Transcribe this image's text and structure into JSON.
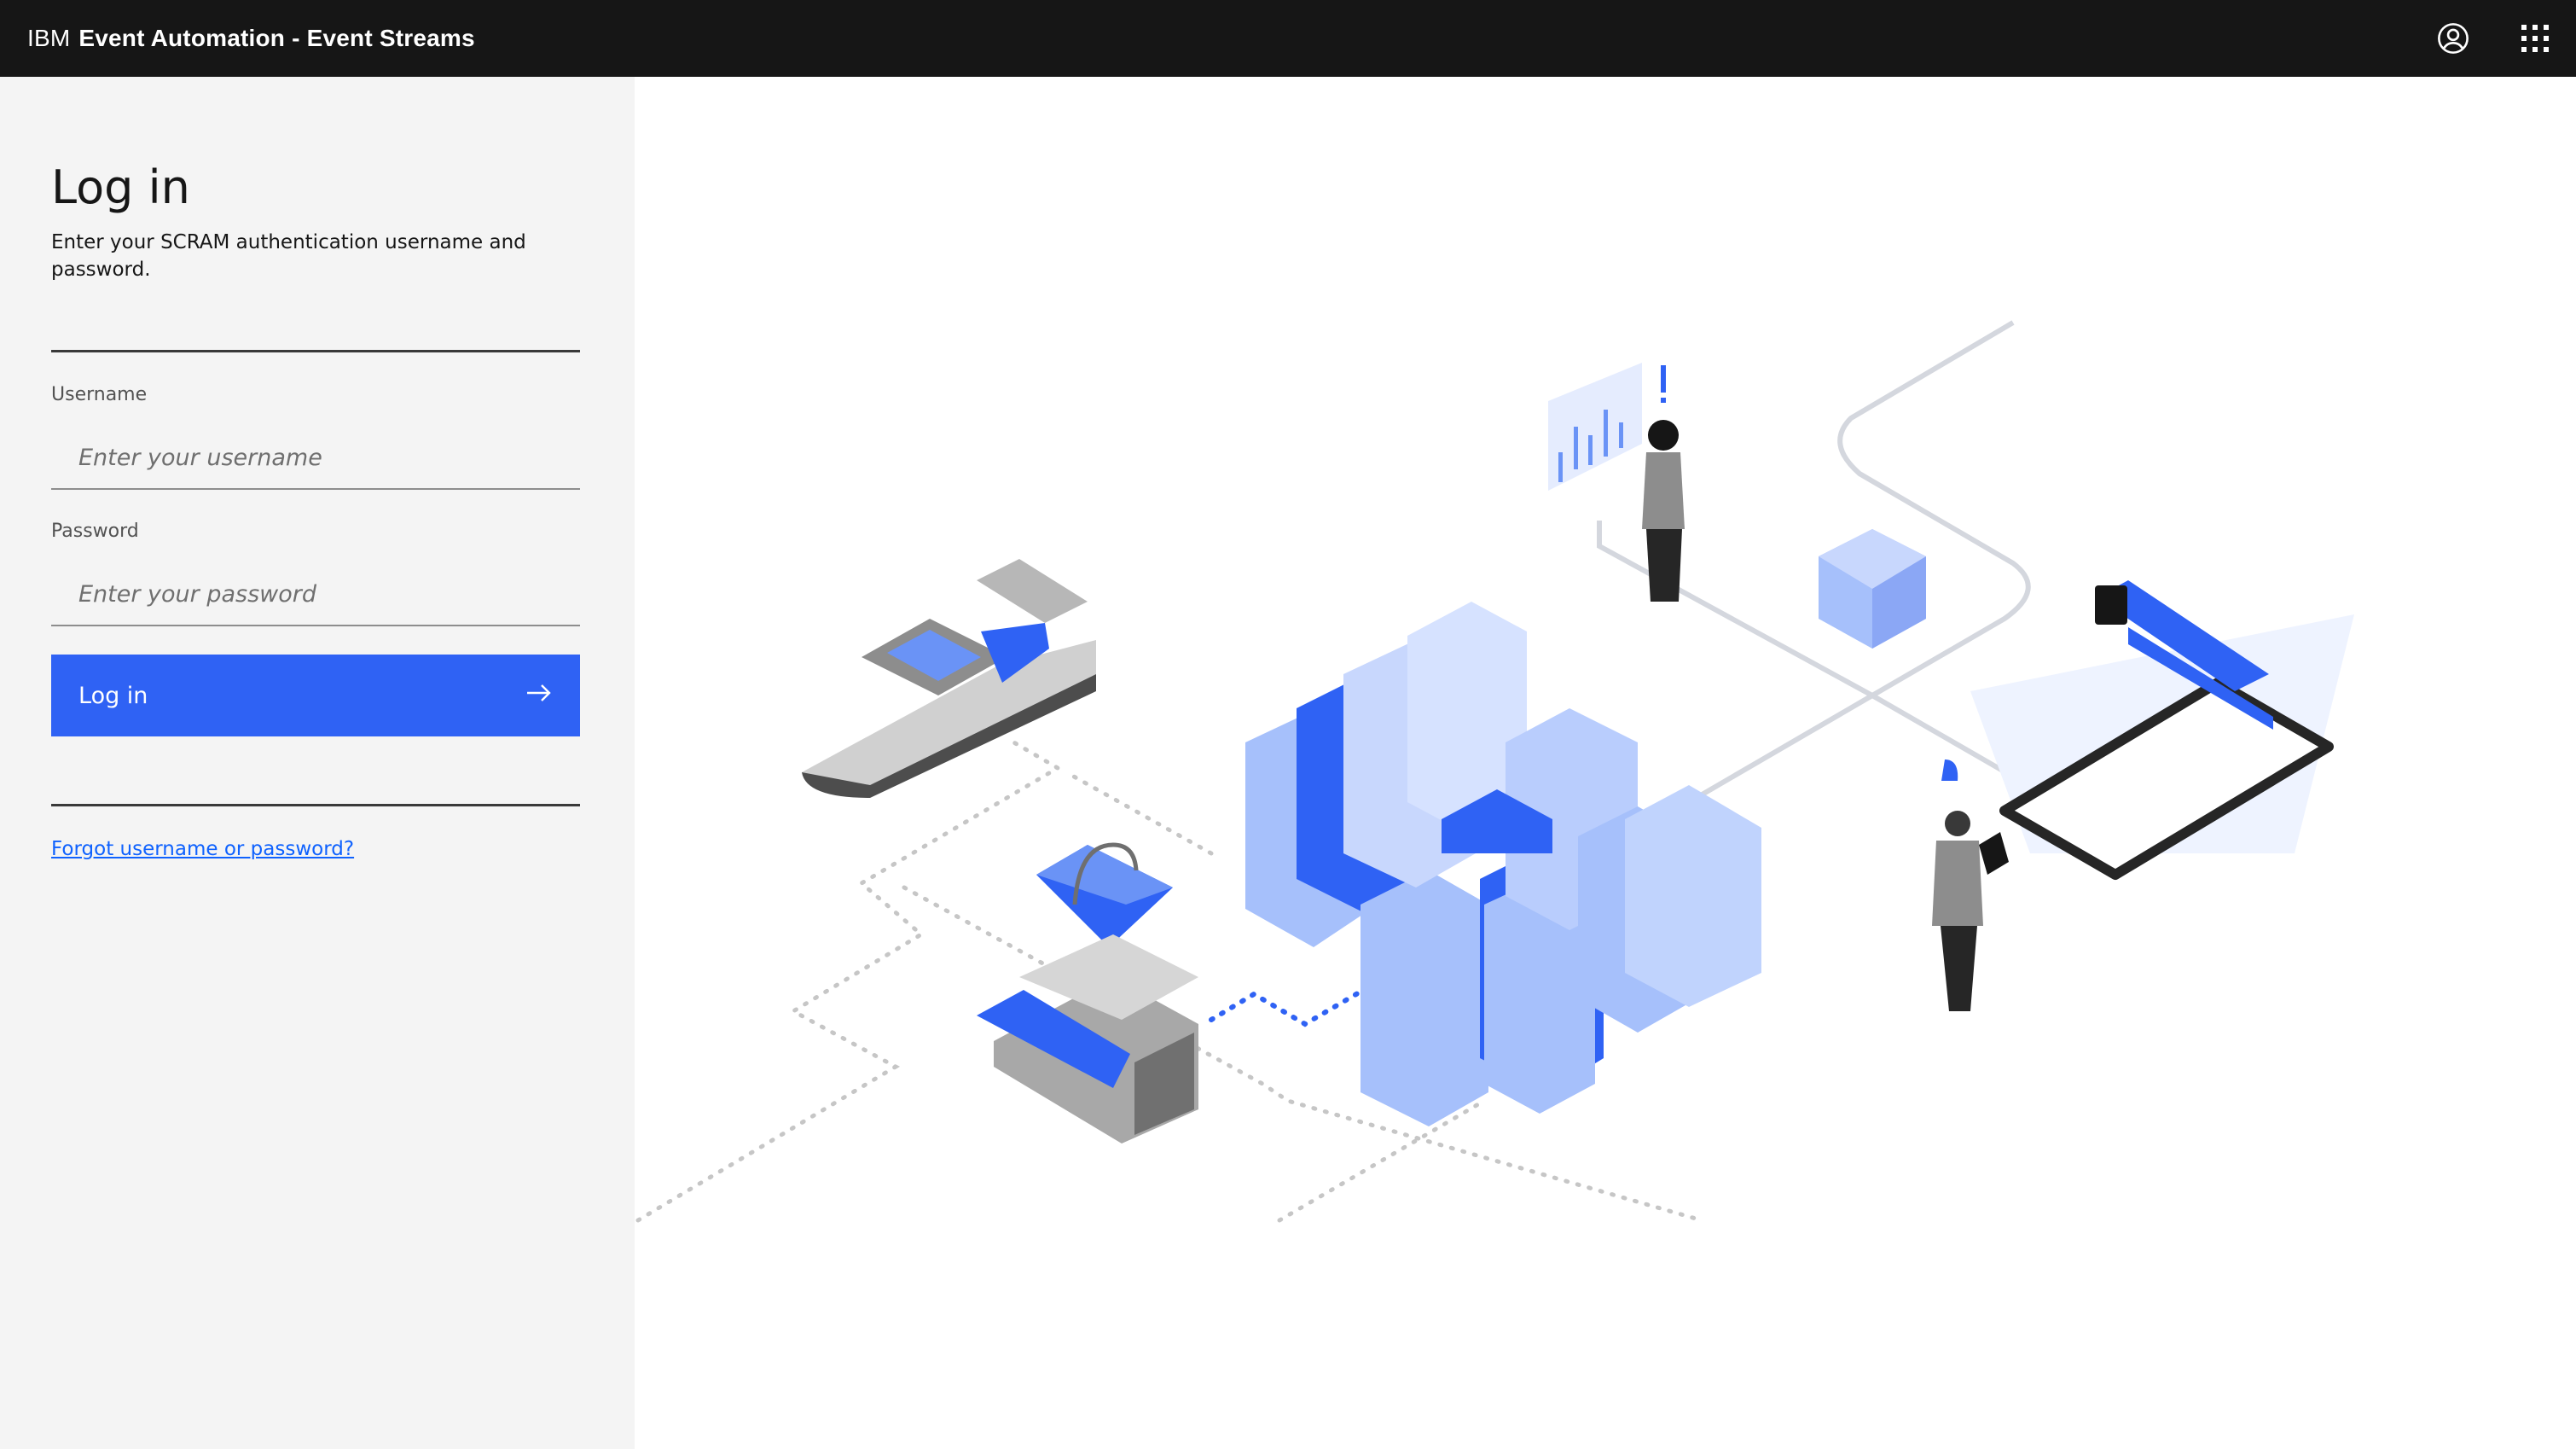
{
  "header": {
    "brand_prefix": "IBM",
    "product_name": "Event Automation - Event Streams",
    "icons": [
      "user-profile-icon",
      "app-switcher-icon"
    ]
  },
  "login": {
    "title": "Log in",
    "subtitle": "Enter your SCRAM authentication username and password.",
    "username_label": "Username",
    "username_placeholder": "Enter your username",
    "password_label": "Password",
    "password_placeholder": "Enter your password",
    "button_label": "Log in",
    "button_icon": "arrow-right-icon",
    "forgot_link": "Forgot username or password?"
  },
  "colors": {
    "header_bg": "#161616",
    "panel_bg": "#f4f4f4",
    "primary": "#2f62f4",
    "link": "#0f62fe",
    "illustration_blue": "#2f62f4",
    "illustration_light_blue": "#a6c0fb"
  }
}
